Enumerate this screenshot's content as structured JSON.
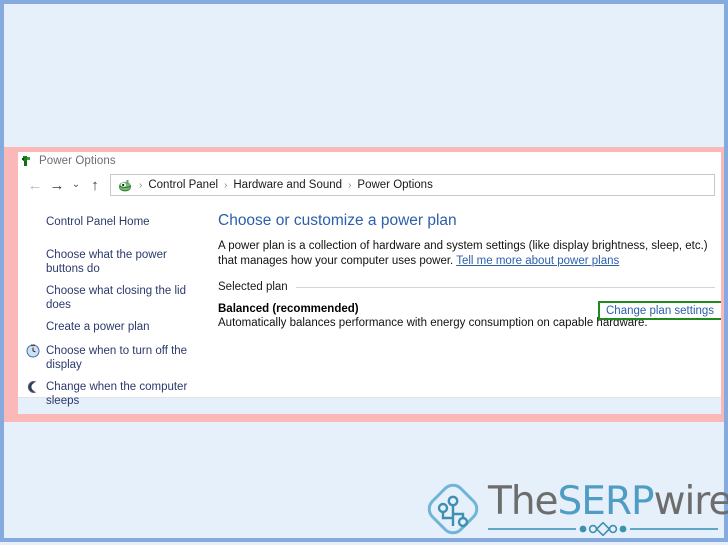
{
  "window": {
    "title": "Power Options",
    "app_icon": "power-plug-icon"
  },
  "toolbar": {
    "back_label": "←",
    "forward_label": "→",
    "recent_label": "⌄",
    "up_label": "↑"
  },
  "breadcrumb": {
    "icon": "control-panel-icon",
    "separator": "›",
    "items": [
      {
        "label": "Control Panel"
      },
      {
        "label": "Hardware and Sound"
      },
      {
        "label": "Power Options"
      }
    ]
  },
  "sidebar": {
    "items": [
      {
        "label": "Control Panel Home",
        "icon": ""
      },
      {
        "label": "Choose what the power buttons do",
        "icon": ""
      },
      {
        "label": "Choose what closing the lid does",
        "icon": ""
      },
      {
        "label": "Create a power plan",
        "icon": ""
      },
      {
        "label": "Choose when to turn off the display",
        "icon": "clock-icon"
      },
      {
        "label": "Change when the computer sleeps",
        "icon": "moon-icon"
      }
    ]
  },
  "main": {
    "heading": "Choose or customize a power plan",
    "intro_text": "A power plan is a collection of hardware and system settings (like display brightness, sleep, etc.) that manages how your computer uses power. ",
    "intro_link": "Tell me more about power plans",
    "group_label": "Selected plan",
    "plan_name": "Balanced (recommended)",
    "plan_description": "Automatically balances performance with energy consumption on capable hardware.",
    "change_plan_link": "Change plan settings"
  },
  "watermark": {
    "text_the": "The",
    "text_serp": "SERP",
    "text_wire": "wire",
    "mark_icon": "circuit-diamond-icon"
  },
  "colors": {
    "frame_border": "#85aade",
    "page_background": "#e6f0fa",
    "highlight_band": "#fbb8b8",
    "accent_link": "#2b5faa",
    "heading": "#2b5faa",
    "sidebar_link": "#2b3a6b",
    "callout_border": "#1f8a1f",
    "logo_accent": "#4f9cc4",
    "logo_grey": "#6d6d6d"
  }
}
